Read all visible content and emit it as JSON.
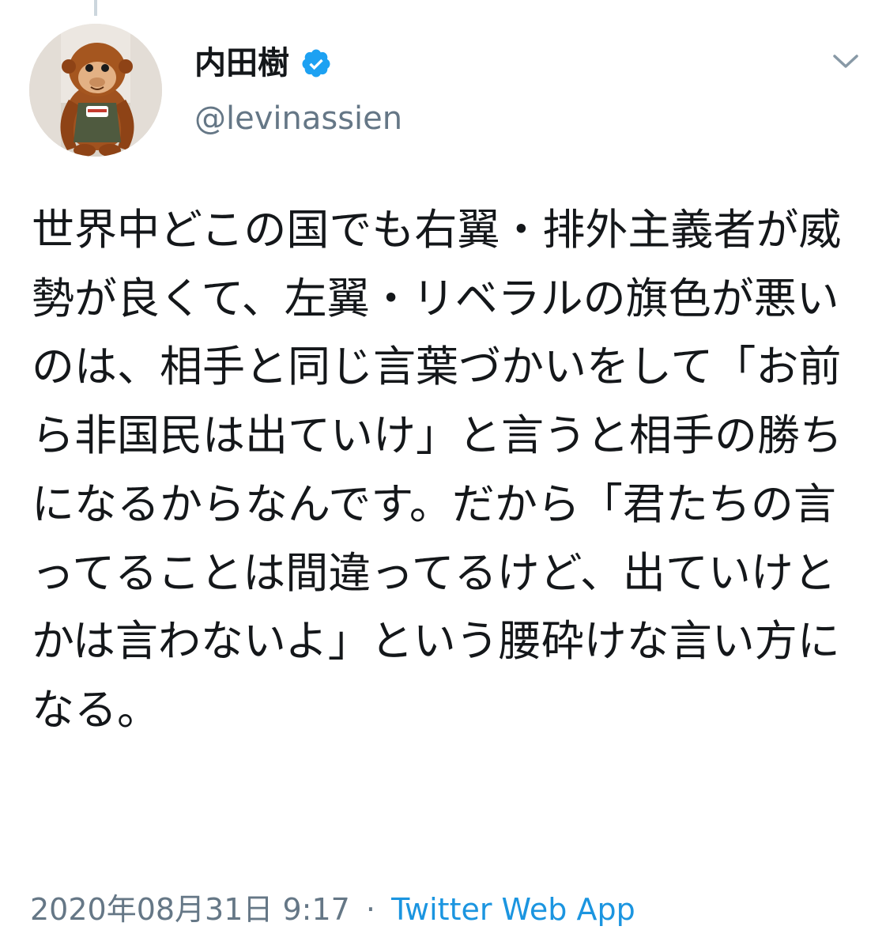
{
  "author": {
    "display_name": "内田樹",
    "handle": "@levinassien",
    "verified": true,
    "avatar_icon": "orangutan-plush-avatar"
  },
  "tweet": {
    "text": "世界中どこの国でも右翼・排外主義者が威勢が良くて、左翼・リベラルの旗色が悪いのは、相手と同じ言葉づかいをして「お前ら非国民は出ていけ」と言うと相手の勝ちになるからなんです。だから「君たちの言ってることは間違ってるけど、出ていけとかは言わないよ」という腰砕けな言い方になる。",
    "timestamp": "2020年08月31日 9:17",
    "separator": "·",
    "source": "Twitter Web App"
  },
  "icons": {
    "verified": "verified-badge-icon",
    "menu": "chevron-down-icon"
  },
  "colors": {
    "verified": "#1da1f2",
    "link": "#1b95e0",
    "secondary_text": "#657786",
    "primary_text": "#14171a"
  }
}
